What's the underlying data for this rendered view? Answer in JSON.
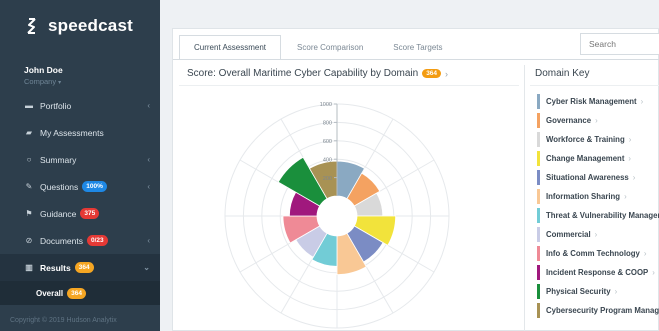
{
  "brand": {
    "name": "speedcast",
    "logo_icon": "speedcast-logo-icon"
  },
  "user": {
    "name": "John Doe",
    "company": "Company"
  },
  "nav": {
    "items": [
      {
        "label": "Portfolio",
        "icon": "briefcase-icon",
        "glyph": "▬",
        "chevron": true
      },
      {
        "label": "My Assessments",
        "icon": "folder-icon",
        "glyph": "▰",
        "chevron": false
      },
      {
        "label": "Summary",
        "icon": "circle-icon",
        "glyph": "○",
        "chevron": true
      },
      {
        "label": "Questions",
        "icon": "edit-icon",
        "glyph": "✎",
        "badge": "100%",
        "badge_color": "blue",
        "chevron": true
      },
      {
        "label": "Guidance",
        "icon": "flag-icon",
        "glyph": "⚑",
        "badge": "375",
        "badge_color": "red",
        "chevron": false
      },
      {
        "label": "Documents",
        "icon": "paperclip-icon",
        "glyph": "⊘",
        "badge": "0/23",
        "badge_color": "red",
        "chevron": true
      },
      {
        "label": "Results",
        "icon": "bar-chart-icon",
        "glyph": "▥",
        "badge": "364",
        "badge_color": "orange",
        "chevron": true,
        "active": true
      }
    ],
    "sub_item": {
      "label": "Overall",
      "badge": "364"
    }
  },
  "copyright": "Copyright © 2019 Hudson Analytix",
  "tabs": [
    {
      "label": "Current Assessment",
      "active": true
    },
    {
      "label": "Score Comparison",
      "active": false
    },
    {
      "label": "Score Targets",
      "active": false
    }
  ],
  "search": {
    "placeholder": "Search"
  },
  "chart_title": "Score: Overall Maritime Cyber Capability by Domain",
  "chart_badge": "364",
  "domain_key_title": "Domain Key",
  "domains": [
    {
      "name": "Cyber Risk Management",
      "color": "#8aa9c2"
    },
    {
      "name": "Governance",
      "color": "#f4a261"
    },
    {
      "name": "Workforce & Training",
      "color": "#d9d9d9"
    },
    {
      "name": "Change Management",
      "color": "#f2e33b"
    },
    {
      "name": "Situational Awareness",
      "color": "#7b8cc4"
    },
    {
      "name": "Information Sharing",
      "color": "#f9c895"
    },
    {
      "name": "Threat & Vulnerability Management",
      "color": "#72ccd6"
    },
    {
      "name": "Commercial",
      "color": "#c9cce6"
    },
    {
      "name": "Info & Comm Technology",
      "color": "#ef8a96"
    },
    {
      "name": "Incident Response & COOP",
      "color": "#a0187d"
    },
    {
      "name": "Physical Security",
      "color": "#1a8f3c"
    },
    {
      "name": "Cybersecurity Program Management",
      "color": "#a89254"
    }
  ],
  "chart_data": {
    "type": "polar-area",
    "radial_ticks": [
      "1000",
      "800",
      "600",
      "400",
      "200"
    ],
    "rmax": 1000,
    "categories": [
      "Cyber Risk Management",
      "Governance",
      "Workforce & Training",
      "Change Management",
      "Situational Awareness",
      "Information Sharing",
      "Threat & Vulnerability Management",
      "Commercial",
      "Info & Comm Technology",
      "Incident Response & COOP",
      "Physical Security",
      "Cybersecurity Program Management"
    ],
    "values": [
      380,
      320,
      280,
      420,
      360,
      420,
      330,
      300,
      370,
      300,
      520,
      380
    ]
  }
}
